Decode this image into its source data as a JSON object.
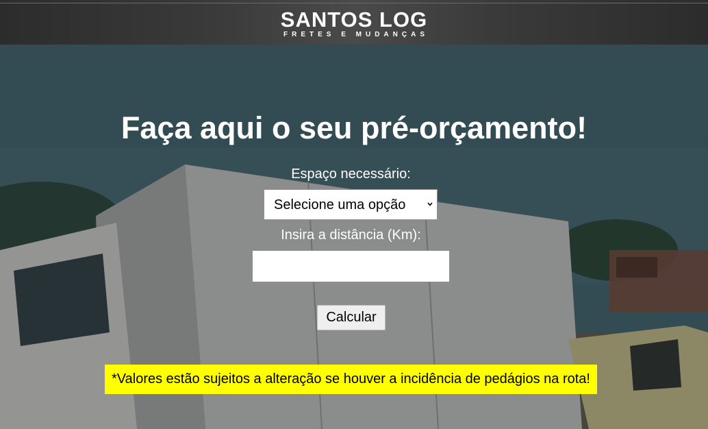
{
  "header": {
    "logo_main": "SANTOS LOG",
    "logo_sub": "FRETES E MUDANÇAS"
  },
  "form": {
    "title": "Faça aqui o seu pré-orçamento!",
    "space_label": "Espaço necessário:",
    "space_select_value": "Selecione uma opção",
    "distance_label": "Insira a distância (Km):",
    "distance_value": "",
    "calculate_label": "Calcular"
  },
  "notice": {
    "text": "*Valores estão sujeitos a alteração se houver a incidência de pedágios na rota!"
  },
  "colors": {
    "header_bg": "#3a3a3a",
    "notice_bg": "#ffff00",
    "title_text": "#ffffff"
  }
}
